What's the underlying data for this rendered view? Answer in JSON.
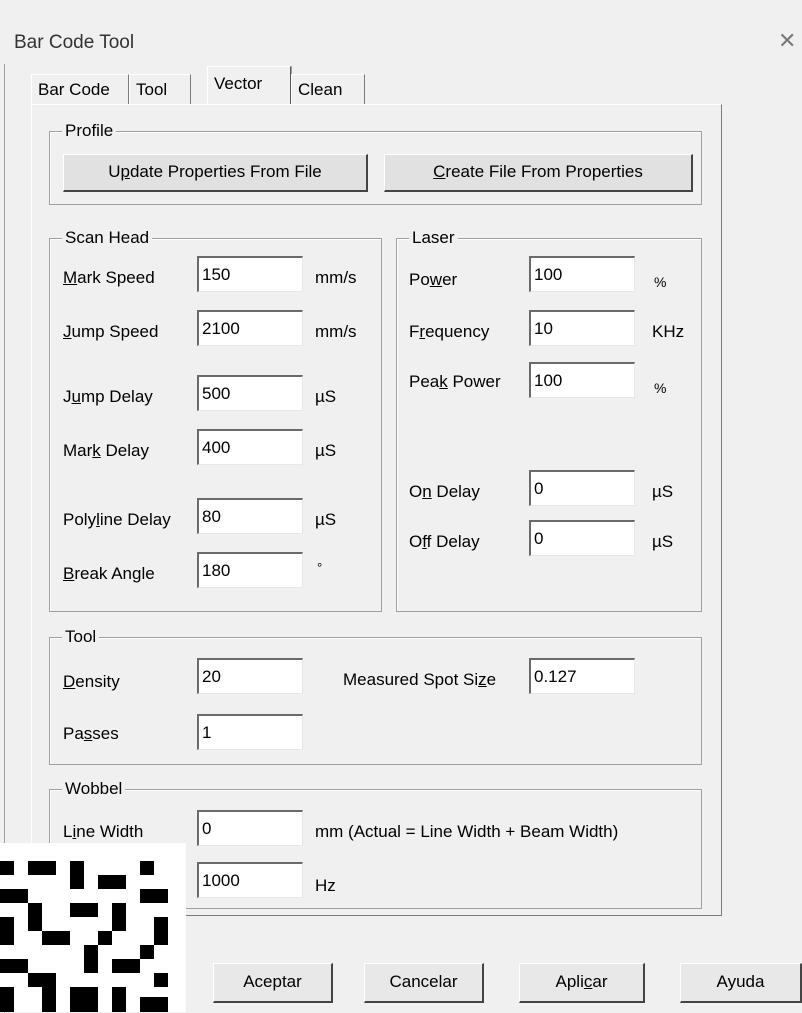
{
  "window": {
    "title": "Bar Code Tool",
    "close_icon": "close-icon"
  },
  "tabs": [
    {
      "label": "Bar Code",
      "active": false
    },
    {
      "label": "Tool",
      "active": false
    },
    {
      "label": "Vector",
      "active": true
    },
    {
      "label": "Clean",
      "active": false
    }
  ],
  "profile": {
    "legend": "Profile",
    "update_pre": "U",
    "update_ul": "p",
    "update_post": "date Properties From File",
    "create_ul": "C",
    "create_post": "reate File From Properties"
  },
  "scan_head": {
    "legend": "Scan Head",
    "rows": [
      {
        "ul": "M",
        "rest": "ark Speed",
        "value": "150",
        "unit": "mm/s"
      },
      {
        "ul": "J",
        "rest": "ump Speed",
        "value": "2100",
        "unit": "mm/s"
      },
      {
        "pre": "J",
        "ul": "u",
        "rest": "mp Delay",
        "value": "500",
        "unit": "µS"
      },
      {
        "pre": "Mar",
        "ul": "k",
        "rest": " Delay",
        "value": "400",
        "unit": "µS"
      },
      {
        "pre": "Poly",
        "ul": "l",
        "rest": "ine Delay",
        "value": "80",
        "unit": "µS"
      },
      {
        "ul": "B",
        "rest": "reak Angle",
        "value": "180",
        "unit": "°"
      }
    ]
  },
  "laser": {
    "legend": "Laser",
    "rows": [
      {
        "pre": "Po",
        "ul": "w",
        "rest": "er",
        "value": "100",
        "unit": "%"
      },
      {
        "pre": "F",
        "ul": "r",
        "rest": "equency",
        "value": "10",
        "unit": "KHz"
      },
      {
        "pre": "Pea",
        "ul": "k",
        "rest": " Power",
        "value": "100",
        "unit": "%"
      },
      {
        "pre": "O",
        "ul": "n",
        "rest": " Delay",
        "value": "0",
        "unit": "µS"
      },
      {
        "pre": "O",
        "ul": "f",
        "rest": "f Delay",
        "value": "0",
        "unit": "µS"
      }
    ]
  },
  "tool": {
    "legend": "Tool",
    "density_ul": "D",
    "density_rest": "ensity",
    "density_value": "20",
    "spot_pre": "Measured Spot Si",
    "spot_ul": "z",
    "spot_rest": "e",
    "spot_value": "0.127",
    "passes_pre": "Pa",
    "passes_ul": "s",
    "passes_rest": "ses",
    "passes_value": "1"
  },
  "wobbel": {
    "legend": "Wobbel",
    "line_width_pre": "L",
    "line_width_ul": "i",
    "line_width_rest": "ne Width",
    "line_width_value": "0",
    "line_width_unit": "mm  (Actual = Line Width + Beam Width)",
    "freq_value": "1000",
    "freq_unit": "Hz"
  },
  "footer": {
    "accept": "Aceptar",
    "cancel": "Cancelar",
    "apply_pre": "Apli",
    "apply_ul": "c",
    "apply_rest": "ar",
    "help": "Ayuda"
  }
}
